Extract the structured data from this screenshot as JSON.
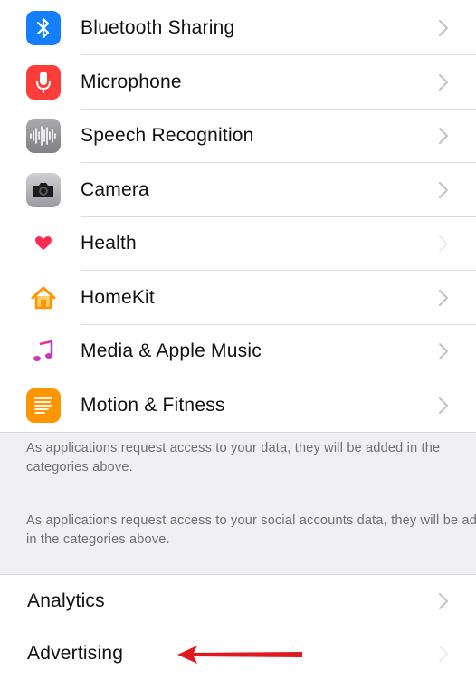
{
  "privacy_list": {
    "items": [
      {
        "label": "Bluetooth Sharing",
        "icon": "bluetooth-icon",
        "color": "#147efb"
      },
      {
        "label": "Microphone",
        "icon": "microphone-icon",
        "color": "#fc3d39"
      },
      {
        "label": "Speech Recognition",
        "icon": "waveform-icon",
        "color": "#8e8e93"
      },
      {
        "label": "Camera",
        "icon": "camera-icon",
        "color": "#8e8e93"
      },
      {
        "label": "Health",
        "icon": "heart-icon",
        "color": "#ff2d55"
      },
      {
        "label": "HomeKit",
        "icon": "home-icon",
        "color": "#ff9500"
      },
      {
        "label": "Media & Apple Music",
        "icon": "music-note-icon",
        "color": "#af52de"
      },
      {
        "label": "Motion & Fitness",
        "icon": "motion-fitness-icon",
        "color": "#ff9500"
      }
    ]
  },
  "footers": {
    "apps_note": "As applications request access to your data, they will be added in the categories above.",
    "social_note": "As applications request access to your social accounts data, they will be added in the categories above."
  },
  "bottom_list": {
    "analytics_label": "Analytics",
    "advertising_label": "Advertising"
  },
  "annotation": {
    "arrow_color": "#e0191d"
  }
}
